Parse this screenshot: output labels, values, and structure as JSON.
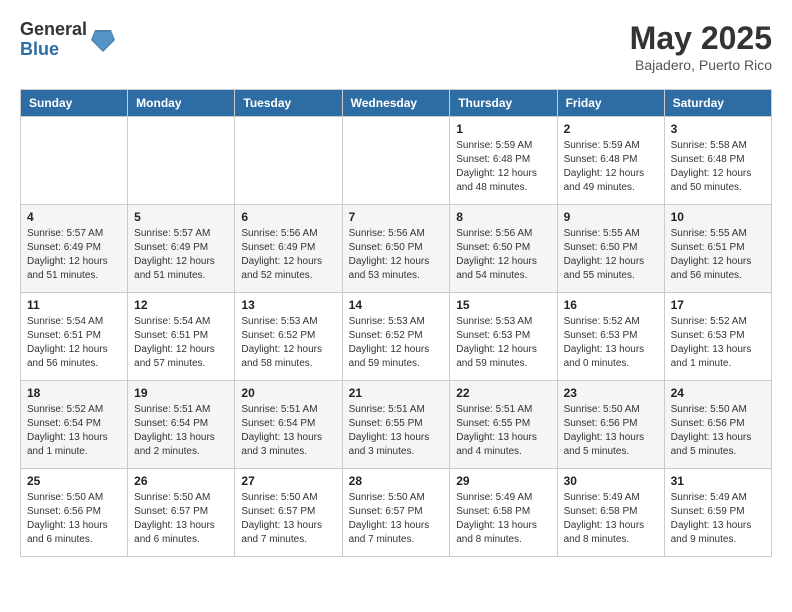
{
  "header": {
    "logo_general": "General",
    "logo_blue": "Blue",
    "month_title": "May 2025",
    "location": "Bajadero, Puerto Rico"
  },
  "weekdays": [
    "Sunday",
    "Monday",
    "Tuesday",
    "Wednesday",
    "Thursday",
    "Friday",
    "Saturday"
  ],
  "weeks": [
    [
      {
        "day": "",
        "info": ""
      },
      {
        "day": "",
        "info": ""
      },
      {
        "day": "",
        "info": ""
      },
      {
        "day": "",
        "info": ""
      },
      {
        "day": "1",
        "info": "Sunrise: 5:59 AM\nSunset: 6:48 PM\nDaylight: 12 hours\nand 48 minutes."
      },
      {
        "day": "2",
        "info": "Sunrise: 5:59 AM\nSunset: 6:48 PM\nDaylight: 12 hours\nand 49 minutes."
      },
      {
        "day": "3",
        "info": "Sunrise: 5:58 AM\nSunset: 6:48 PM\nDaylight: 12 hours\nand 50 minutes."
      }
    ],
    [
      {
        "day": "4",
        "info": "Sunrise: 5:57 AM\nSunset: 6:49 PM\nDaylight: 12 hours\nand 51 minutes."
      },
      {
        "day": "5",
        "info": "Sunrise: 5:57 AM\nSunset: 6:49 PM\nDaylight: 12 hours\nand 51 minutes."
      },
      {
        "day": "6",
        "info": "Sunrise: 5:56 AM\nSunset: 6:49 PM\nDaylight: 12 hours\nand 52 minutes."
      },
      {
        "day": "7",
        "info": "Sunrise: 5:56 AM\nSunset: 6:50 PM\nDaylight: 12 hours\nand 53 minutes."
      },
      {
        "day": "8",
        "info": "Sunrise: 5:56 AM\nSunset: 6:50 PM\nDaylight: 12 hours\nand 54 minutes."
      },
      {
        "day": "9",
        "info": "Sunrise: 5:55 AM\nSunset: 6:50 PM\nDaylight: 12 hours\nand 55 minutes."
      },
      {
        "day": "10",
        "info": "Sunrise: 5:55 AM\nSunset: 6:51 PM\nDaylight: 12 hours\nand 56 minutes."
      }
    ],
    [
      {
        "day": "11",
        "info": "Sunrise: 5:54 AM\nSunset: 6:51 PM\nDaylight: 12 hours\nand 56 minutes."
      },
      {
        "day": "12",
        "info": "Sunrise: 5:54 AM\nSunset: 6:51 PM\nDaylight: 12 hours\nand 57 minutes."
      },
      {
        "day": "13",
        "info": "Sunrise: 5:53 AM\nSunset: 6:52 PM\nDaylight: 12 hours\nand 58 minutes."
      },
      {
        "day": "14",
        "info": "Sunrise: 5:53 AM\nSunset: 6:52 PM\nDaylight: 12 hours\nand 59 minutes."
      },
      {
        "day": "15",
        "info": "Sunrise: 5:53 AM\nSunset: 6:53 PM\nDaylight: 12 hours\nand 59 minutes."
      },
      {
        "day": "16",
        "info": "Sunrise: 5:52 AM\nSunset: 6:53 PM\nDaylight: 13 hours\nand 0 minutes."
      },
      {
        "day": "17",
        "info": "Sunrise: 5:52 AM\nSunset: 6:53 PM\nDaylight: 13 hours\nand 1 minute."
      }
    ],
    [
      {
        "day": "18",
        "info": "Sunrise: 5:52 AM\nSunset: 6:54 PM\nDaylight: 13 hours\nand 1 minute."
      },
      {
        "day": "19",
        "info": "Sunrise: 5:51 AM\nSunset: 6:54 PM\nDaylight: 13 hours\nand 2 minutes."
      },
      {
        "day": "20",
        "info": "Sunrise: 5:51 AM\nSunset: 6:54 PM\nDaylight: 13 hours\nand 3 minutes."
      },
      {
        "day": "21",
        "info": "Sunrise: 5:51 AM\nSunset: 6:55 PM\nDaylight: 13 hours\nand 3 minutes."
      },
      {
        "day": "22",
        "info": "Sunrise: 5:51 AM\nSunset: 6:55 PM\nDaylight: 13 hours\nand 4 minutes."
      },
      {
        "day": "23",
        "info": "Sunrise: 5:50 AM\nSunset: 6:56 PM\nDaylight: 13 hours\nand 5 minutes."
      },
      {
        "day": "24",
        "info": "Sunrise: 5:50 AM\nSunset: 6:56 PM\nDaylight: 13 hours\nand 5 minutes."
      }
    ],
    [
      {
        "day": "25",
        "info": "Sunrise: 5:50 AM\nSunset: 6:56 PM\nDaylight: 13 hours\nand 6 minutes."
      },
      {
        "day": "26",
        "info": "Sunrise: 5:50 AM\nSunset: 6:57 PM\nDaylight: 13 hours\nand 6 minutes."
      },
      {
        "day": "27",
        "info": "Sunrise: 5:50 AM\nSunset: 6:57 PM\nDaylight: 13 hours\nand 7 minutes."
      },
      {
        "day": "28",
        "info": "Sunrise: 5:50 AM\nSunset: 6:57 PM\nDaylight: 13 hours\nand 7 minutes."
      },
      {
        "day": "29",
        "info": "Sunrise: 5:49 AM\nSunset: 6:58 PM\nDaylight: 13 hours\nand 8 minutes."
      },
      {
        "day": "30",
        "info": "Sunrise: 5:49 AM\nSunset: 6:58 PM\nDaylight: 13 hours\nand 8 minutes."
      },
      {
        "day": "31",
        "info": "Sunrise: 5:49 AM\nSunset: 6:59 PM\nDaylight: 13 hours\nand 9 minutes."
      }
    ]
  ]
}
